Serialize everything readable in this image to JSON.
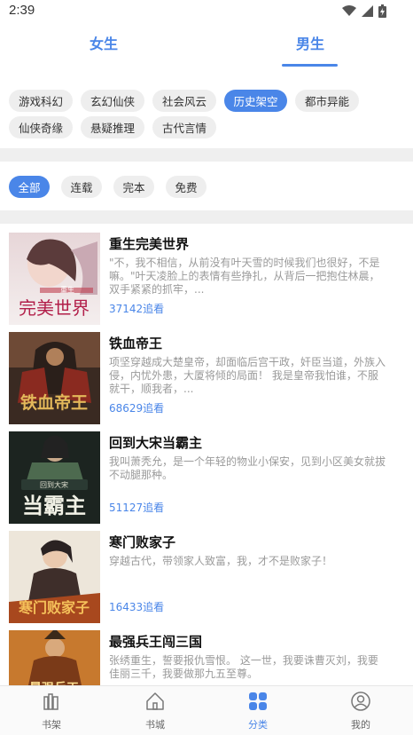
{
  "status_bar": {
    "time": "2:39"
  },
  "gender_tabs": {
    "female": "女生",
    "male": "男生",
    "selected": "男生"
  },
  "categories": {
    "row1": [
      "游戏科幻",
      "玄幻仙侠",
      "社会风云",
      "历史架空",
      "都市异能"
    ],
    "row2": [
      "仙侠奇缘",
      "悬疑推理",
      "古代言情"
    ],
    "selected": "历史架空"
  },
  "status_filters": {
    "items": [
      "全部",
      "连载",
      "完本",
      "免费"
    ],
    "selected": "全部"
  },
  "books": [
    {
      "title": "重生完美世界",
      "description": "\"不，我不相信，从前没有叶天雪的时候我们也很好，不是嘛。\"叶天凌脸上的表情有些挣扎，从背后一把抱住林晨，双手紧紧的抓牢，...",
      "follow": "37142追看",
      "cover_text": "完美世界",
      "cover_small": "重生"
    },
    {
      "title": "铁血帝王",
      "description": "项坚穿越成大楚皇帝，却面临后宫干政，奸臣当道，外族入侵，内忧外患，大厦将倾的局面！ 我是皇帝我怕谁，不服就干，顺我者，...",
      "follow": "68629追看",
      "cover_text": "铁血帝王"
    },
    {
      "title": "回到大宋当霸主",
      "description": "我叫萧秃允，是一个年轻的物业小保安，见到小区美女就拔不动腿那种。",
      "follow": "51127追看",
      "cover_text": "当霸主",
      "cover_small": "回到大宋"
    },
    {
      "title": "寒门败家子",
      "description": "穿越古代，带领家人致富，我，才不是败家子！",
      "follow": "16433追看",
      "cover_text": "寒门败家子"
    },
    {
      "title": "最强兵王闯三国",
      "description": "张绣重生，誓要报仇雪恨。 这一世，我要诛曹灭刘，我要佳丽三千，我要做那九五至尊。",
      "follow": "",
      "cover_text": "最强兵王"
    }
  ],
  "bottom_nav": {
    "items": [
      {
        "label": "书架",
        "icon": "bookshelf-icon"
      },
      {
        "label": "书城",
        "icon": "home-icon"
      },
      {
        "label": "分类",
        "icon": "category-icon"
      },
      {
        "label": "我的",
        "icon": "profile-icon"
      }
    ],
    "selected": "分类"
  },
  "colors": {
    "accent": "#4a86e8",
    "chip_bg": "#eeeeee",
    "text_muted": "#9a9a9a"
  }
}
